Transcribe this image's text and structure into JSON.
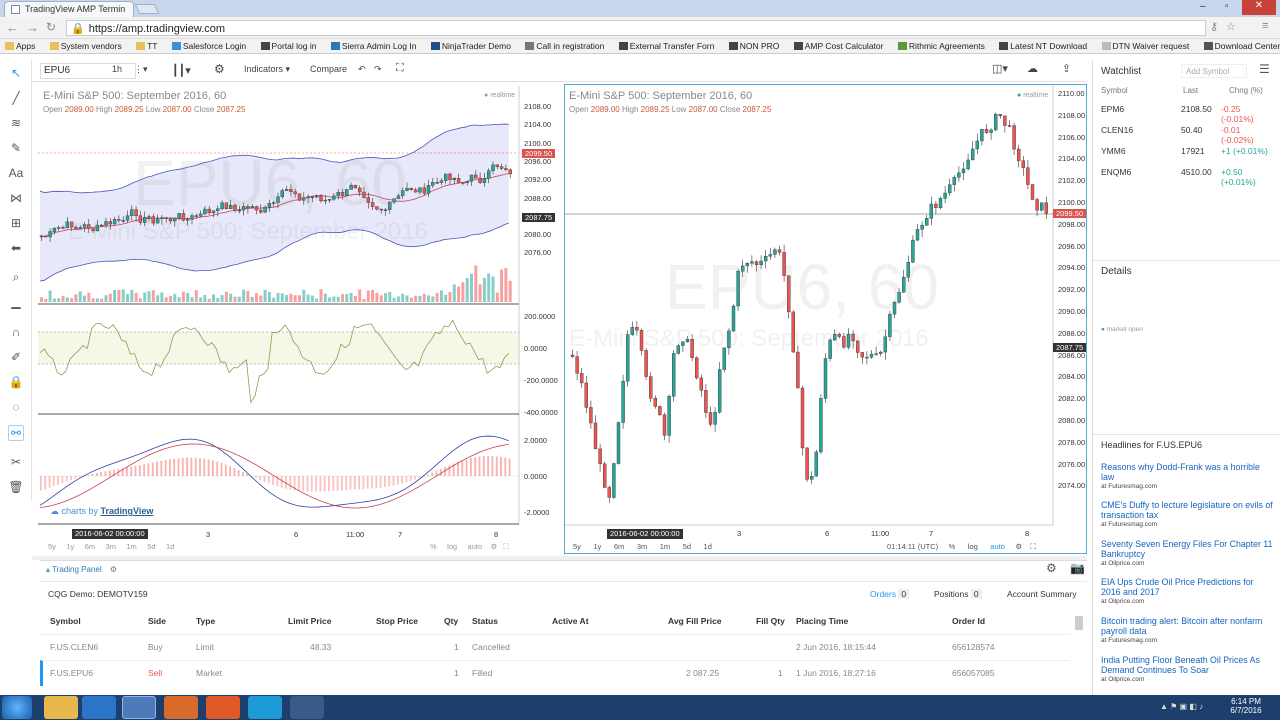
{
  "browser": {
    "tab_title": "TradingView AMP Termin",
    "url": "https://amp.tradingview.com",
    "bookmarks": [
      "Apps",
      "System vendors",
      "TT",
      "Salesforce Login",
      "Portal log in",
      "Sierra Admin Log In",
      "NinjaTrader Demo",
      "Call in registration",
      "External Transfer Forn",
      "NON PRO",
      "AMP Cost Calculator",
      "Rithmic Agreements",
      "Latest NT Download",
      "DTN Waiver request",
      "Download Center"
    ]
  },
  "toolbar": {
    "symbol": "EPU6",
    "interval": "1h",
    "indicators_label": "Indicators",
    "compare_label": "Compare"
  },
  "left_chart": {
    "title": "E-Mini S&P 500: September 2016, 60",
    "ohlc": {
      "open": "2089.00",
      "high": "2089.25",
      "low": "2087.00",
      "close": "2087.25"
    },
    "realtime": "realtime",
    "watermark": "EPU6, 60",
    "watermark_sub": "E-Mini S&P 500: September 2016",
    "price_ticks": [
      "2108.00",
      "2104.00",
      "2100.00",
      "2096.00",
      "2092.00",
      "2088.00",
      "2084.00",
      "2080.00",
      "2076.00"
    ],
    "last_price_tag": "2099.50",
    "cross_price_tag": "2087.75",
    "osc1_ticks": [
      "200.0000",
      "0.0000",
      "-200.0000",
      "-400.0000"
    ],
    "osc2_ticks": [
      "2.0000",
      "0.0000",
      "-2.0000"
    ],
    "x_ticks": [
      "3",
      "6",
      "11:00",
      "7",
      "8"
    ],
    "date_label": "2016-06-02 00:00:00",
    "credit": "charts by",
    "credit_brand": "TradingView",
    "ranges": [
      "5y",
      "1y",
      "6m",
      "3m",
      "1m",
      "5d",
      "1d"
    ],
    "right_ctrls": [
      "%",
      "log",
      "auto"
    ]
  },
  "right_chart": {
    "title": "E-Mini S&P 500: September 2016, 60",
    "ohlc": {
      "open": "2089.00",
      "high": "2089.25",
      "low": "2087.00",
      "close": "2087.25"
    },
    "realtime": "realtime",
    "watermark": "EPU6, 60",
    "watermark_sub": "E-Mini S&P 500: September 2016",
    "price_ticks": [
      "2110.00",
      "2108.00",
      "2106.00",
      "2104.00",
      "2102.00",
      "2100.00",
      "2098.00",
      "2096.00",
      "2094.00",
      "2092.00",
      "2090.00",
      "2088.00",
      "2086.00",
      "2084.00",
      "2082.00",
      "2080.00",
      "2078.00",
      "2076.00",
      "2074.00"
    ],
    "last_price_tag": "2099.50",
    "cross_price_tag": "2087.75",
    "x_ticks": [
      "3",
      "6",
      "11:00",
      "7",
      "8"
    ],
    "date_label": "2016-06-02 00:00:00",
    "ranges": [
      "5y",
      "1y",
      "6m",
      "3m",
      "1m",
      "5d",
      "1d"
    ],
    "clock": "01:14:11 (UTC)",
    "right_ctrls": [
      "%",
      "log",
      "auto"
    ]
  },
  "watchlist": {
    "title": "Watchlist",
    "add_placeholder": "Add Symbol",
    "headers": [
      "Symbol",
      "Last",
      "Chng (%)"
    ],
    "rows": [
      {
        "symbol": "EPM6",
        "last": "2108.50",
        "chg": "-0.25 (-0.01%)",
        "dir": "down"
      },
      {
        "symbol": "CLEN16",
        "last": "50.40",
        "chg": "-0.01 (-0.02%)",
        "dir": "down"
      },
      {
        "symbol": "YMM6",
        "last": "17921",
        "chg": "+1 (+0.01%)",
        "dir": "up"
      },
      {
        "symbol": "ENQM6",
        "last": "4510.00",
        "chg": "+0.50 (+0.01%)",
        "dir": "up"
      }
    ],
    "details_title": "Details",
    "market_status": "market open",
    "headlines_title": "Headlines for F.US.EPU6",
    "news": [
      {
        "title": "Reasons why Dodd-Frank was a horrible law",
        "src": "Futuresmag.com"
      },
      {
        "title": "CME's Duffy to lecture legislature on evils of transaction tax",
        "src": "Futuresmag.com"
      },
      {
        "title": "Seventy Seven Energy Files For Chapter 11 Bankruptcy",
        "src": "Oilprice.com"
      },
      {
        "title": "EIA Ups Crude Oil Price Predictions for 2016 and 2017",
        "src": "Oilprice.com"
      },
      {
        "title": "Bitcoin trading alert: Bitcoin after nonfarm payroll data",
        "src": "Futuresmag.com"
      },
      {
        "title": "India Putting Floor Beneath Oil Prices As Demand Continues To Soar",
        "src": "Oilprice.com"
      }
    ]
  },
  "trading_panel": {
    "label": "Trading Panel",
    "account": "CQG Demo: DEMOTV159",
    "tabs": [
      {
        "label": "Orders",
        "count": "0"
      },
      {
        "label": "Positions",
        "count": "0"
      },
      {
        "label": "Account Summary",
        "count": ""
      }
    ],
    "headers": [
      "Symbol",
      "Side",
      "Type",
      "Limit Price",
      "Stop Price",
      "Qty",
      "Status",
      "Active At",
      "Avg Fill Price",
      "Fill Qty",
      "Placing Time",
      "Order Id"
    ],
    "rows": [
      {
        "symbol": "F.US.CLEN6",
        "side": "Buy",
        "type": "Limit",
        "limit": "48.33",
        "stop": "",
        "qty": "1",
        "status": "Cancelled",
        "active": "",
        "avg": "",
        "fillqty": "",
        "time": "2 Jun 2016, 18:15:44",
        "id": "656128574"
      },
      {
        "symbol": "F.US.EPU6",
        "side": "Sell",
        "type": "Market",
        "limit": "",
        "stop": "",
        "qty": "1",
        "status": "Filled",
        "active": "",
        "avg": "2 087.25",
        "fillqty": "1",
        "time": "1 Jun 2016, 18:27:16",
        "id": "656057085"
      }
    ]
  },
  "taskbar": {
    "time": "6:14 PM",
    "date": "6/7/2016"
  }
}
